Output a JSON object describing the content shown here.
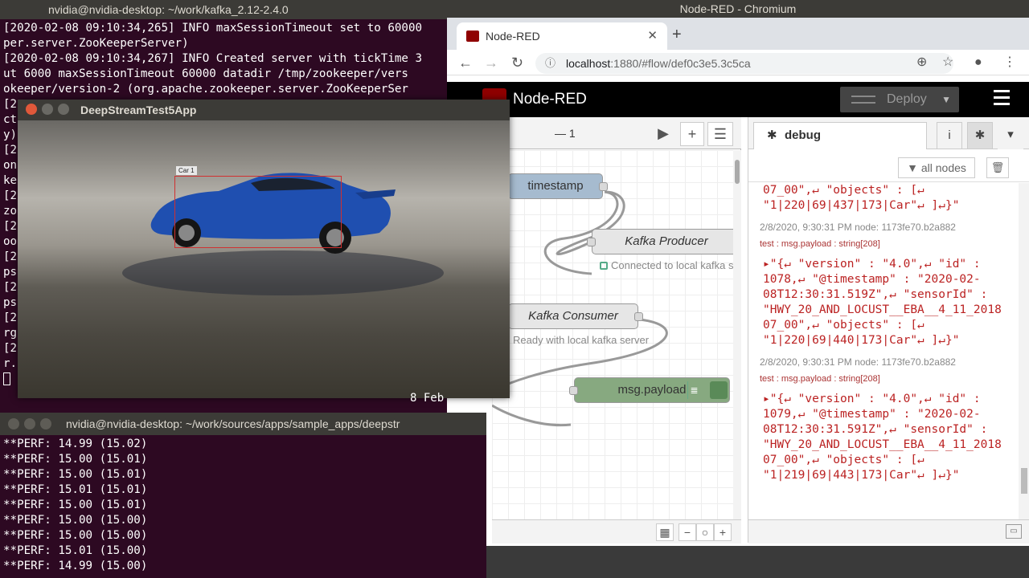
{
  "terminal1": {
    "title": "nvidia@nvidia-desktop: ~/work/kafka_2.12-2.4.0",
    "lines": [
      "[2020-02-08 09:10:34,265] INFO maxSessionTimeout set to 60000",
      "per.server.ZooKeeperServer)",
      "[2020-02-08 09:10:34,267] INFO Created server with tickTime 3",
      "ut 6000 maxSessionTimeout 60000 datadir /tmp/zookeeper/vers",
      "okeeper/version-2 (org.apache.zookeeper.server.ZooKeeperSer",
      "[2",
      "ct",
      "y)",
      "[2",
      "on",
      "ke",
      "[2",
      "zo",
      "[2",
      "oo",
      "[2",
      "ps",
      "[2",
      "ps",
      "[2",
      "rg",
      "[2",
      "r."
    ],
    "tail_fragment": "8 Feb"
  },
  "deepstream": {
    "title": "DeepStreamTest5App",
    "detection_label": "Car 1"
  },
  "terminal2": {
    "title": "nvidia@nvidia-desktop: ~/work/sources/apps/sample_apps/deepstr",
    "lines": [
      "**PERF: 14.99 (15.02)",
      "**PERF: 15.00 (15.01)",
      "**PERF: 15.00 (15.01)",
      "**PERF: 15.01 (15.01)",
      "**PERF: 15.00 (15.01)",
      "**PERF: 15.00 (15.00)",
      "**PERF: 15.00 (15.00)",
      "**PERF: 15.01 (15.00)",
      "**PERF: 14.99 (15.00)"
    ]
  },
  "browser": {
    "window_title": "Node-RED - Chromium",
    "tab_title": "Node-RED",
    "url_host": "localhost",
    "url_path": ":1880/#flow/def0c3e5.3c5ca"
  },
  "nodered": {
    "app_name": "Node-RED",
    "deploy_label": "Deploy",
    "flow_tab": "1",
    "nodes": {
      "timestamp": "timestamp",
      "producer": "Kafka Producer",
      "producer_status": "Connected to local kafka server",
      "consumer": "Kafka Consumer",
      "consumer_status": "Ready with local kafka server",
      "debug": "msg.payload"
    },
    "sidebar": {
      "tab": "debug",
      "filter": "all nodes",
      "messages": [
        {
          "meta": "",
          "topic": "",
          "body": [
            "07_00\",↵ \"objects\" : [↵",
            "\"1|220|69|437|173|Car\"↵ ]↵}\""
          ]
        },
        {
          "meta": "2/8/2020, 9:30:31 PM   node: 1173fe70.b2a882",
          "topic": "test : msg.payload : string[208]",
          "body": [
            "▸\"{↵ \"version\" : \"4.0\",↵ \"id\" :",
            "1078,↵ \"@timestamp\" : \"2020-02-",
            "08T12:30:31.519Z\",↵ \"sensorId\" :",
            "\"HWY_20_AND_LOCUST__EBA__4_11_2018",
            "07_00\",↵ \"objects\" : [↵",
            "\"1|220|69|440|173|Car\"↵ ]↵}\""
          ]
        },
        {
          "meta": "2/8/2020, 9:30:31 PM   node: 1173fe70.b2a882",
          "topic": "test : msg.payload : string[208]",
          "body": [
            "▸\"{↵ \"version\" : \"4.0\",↵ \"id\" :",
            "1079,↵ \"@timestamp\" : \"2020-02-",
            "08T12:30:31.591Z\",↵ \"sensorId\" :",
            "\"HWY_20_AND_LOCUST__EBA__4_11_2018",
            "07_00\",↵ \"objects\" : [↵",
            "\"1|219|69|443|173|Car\"↵ ]↵}\""
          ]
        }
      ]
    }
  },
  "colors": {
    "terminal_bg": "#2d0922",
    "nodered_red": "#8f0000",
    "timestamp_node": "#a6bbcf",
    "kafka_node": "#e6e6e6",
    "debug_node": "#87a980",
    "debug_text": "#b22222"
  }
}
